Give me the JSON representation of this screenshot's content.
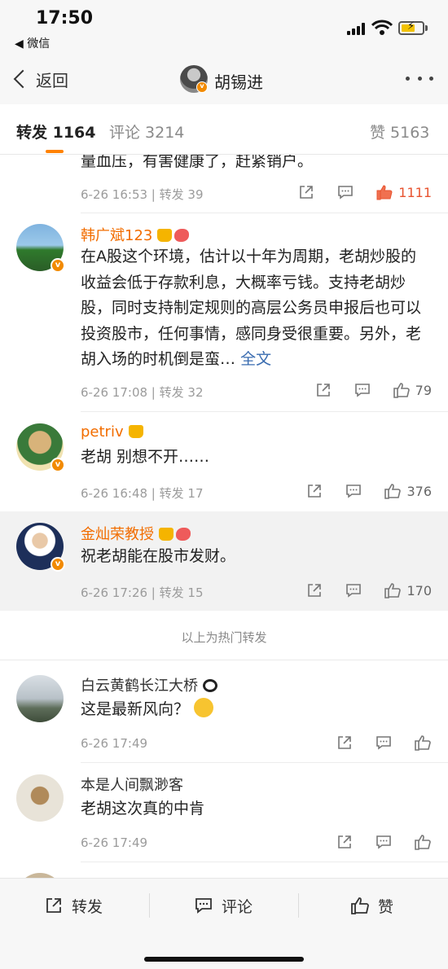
{
  "status_bar": {
    "time": "17:50",
    "back_app": "◀ 微信"
  },
  "nav": {
    "back_label": "返回",
    "title": "胡锡进"
  },
  "tabs": [
    {
      "label": "转发 1164"
    },
    {
      "label": "评论 3214"
    },
    {
      "label": "赞 5163"
    }
  ],
  "posts": [
    {
      "content": "量血压，有害健康了，赶紧销户。",
      "meta": "6-26 16:53 | 转发 39",
      "likes": "1111"
    },
    {
      "name": "韩广斌123",
      "content": "在A股这个环境，估计以十年为周期，老胡炒股的收益会低于存款利息，大概率亏钱。支持老胡炒股，同时支持制定规则的高层公务员申报后也可以投资股市，任何事情，感同身受很重要。另外，老胡入场的时机倒是蛮…",
      "full_text_link": "全文",
      "meta": "6-26 17:08 | 转发 32",
      "likes": "79"
    },
    {
      "name": "petriv",
      "content": "老胡 别想不开……",
      "meta": "6-26 16:48 | 转发 17",
      "likes": "376"
    },
    {
      "name": "金灿荣教授",
      "content": "祝老胡能在股市发财。",
      "meta": "6-26 17:26 | 转发 15",
      "likes": "170"
    },
    {
      "name": "白云黄鹤长江大桥",
      "content": "这是最新风向？",
      "meta": "6-26 17:49",
      "likes": ""
    },
    {
      "name": "本是人间飘渺客",
      "content": "老胡这次真的中肯",
      "meta": "6-26 17:49",
      "likes": ""
    }
  ],
  "hot_note": "以上为热门转发",
  "toolbar": {
    "repost": "转发",
    "comment": "评论",
    "like": "赞"
  },
  "colors": {
    "accent": "#ff8200",
    "vip_name": "#f26d00",
    "link": "#3a6cb0",
    "hot_like": "#e8532f"
  }
}
